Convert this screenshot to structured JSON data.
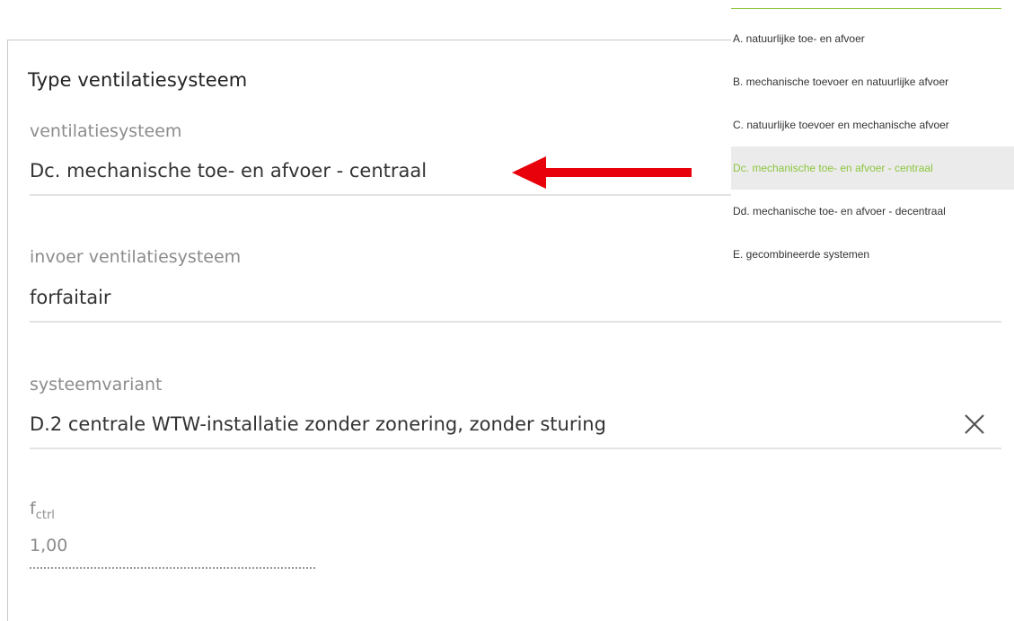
{
  "panel": {
    "title": "Type ventilatiesysteem"
  },
  "fields": {
    "ventilatiesysteem": {
      "label": "ventilatiesysteem",
      "value": "Dc. mechanische toe- en afvoer - centraal"
    },
    "invoer": {
      "label": "invoer ventilatiesysteem",
      "value": "forfaitair"
    },
    "systeemvariant": {
      "label": "systeemvariant",
      "value": "D.2 centrale WTW-installatie zonder zonering, zonder sturing",
      "clear_icon": "close-icon"
    },
    "fctrl": {
      "label_main": "f",
      "label_sub": "ctrl",
      "value": "1,00"
    }
  },
  "annotation": {
    "arrow_color": "#e8000b",
    "icon": "arrow-left-icon"
  },
  "dropdown": {
    "accent_color": "#8dc63f",
    "selected_index": 3,
    "items": [
      {
        "label": "A. natuurlijke toe- en afvoer"
      },
      {
        "label": "B. mechanische toevoer en natuurlijke afvoer"
      },
      {
        "label": "C. natuurlijke toevoer en mechanische afvoer"
      },
      {
        "label": "Dc. mechanische toe- en afvoer - centraal"
      },
      {
        "label": "Dd. mechanische toe- en afvoer - decentraal"
      },
      {
        "label": "E. gecombineerde systemen"
      }
    ]
  }
}
